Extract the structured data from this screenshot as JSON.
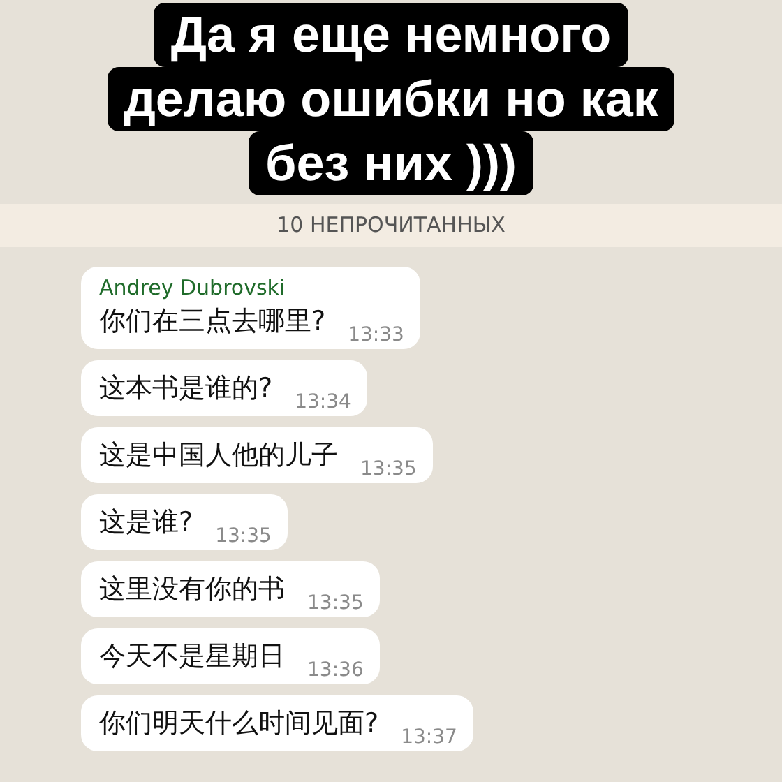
{
  "caption": {
    "lines": [
      "Да я еще немного",
      "делаю ошибки но как",
      "без них )))"
    ]
  },
  "unread_banner": "10 НЕПРОЧИТАННЫХ",
  "messages": [
    {
      "sender": "Andrey Dubrovski",
      "text": "你们在三点去哪里?",
      "time": "13:33"
    },
    {
      "text": "这本书是谁的?",
      "time": "13:34"
    },
    {
      "text": "这是中国人他的儿子",
      "time": "13:35"
    },
    {
      "text": "这是谁?",
      "time": "13:35"
    },
    {
      "text": "这里没有你的书",
      "time": "13:35"
    },
    {
      "text": "今天不是星期日",
      "time": "13:36"
    },
    {
      "text": "你们明天什么时间见面?",
      "time": "13:37"
    }
  ]
}
